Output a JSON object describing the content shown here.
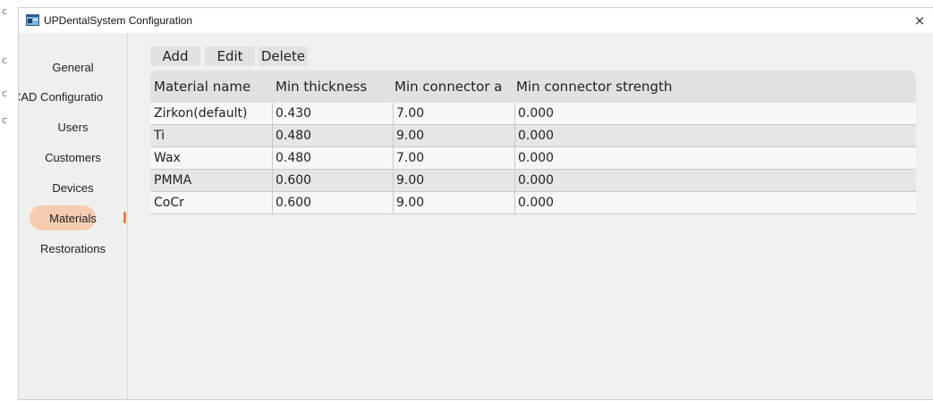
{
  "window": {
    "title": "UPDentalSystem Configuration",
    "close_glyph": "×",
    "app_icon": "app-icon"
  },
  "edge_fragments": [
    "c",
    "c",
    "c",
    "c",
    "c"
  ],
  "sidebar": {
    "items": [
      {
        "label": "General",
        "active": false
      },
      {
        "label": "CAD Configuratio",
        "active": false
      },
      {
        "label": "Users",
        "active": false
      },
      {
        "label": "Customers",
        "active": false
      },
      {
        "label": "Devices",
        "active": false
      },
      {
        "label": "Materials",
        "active": true
      },
      {
        "label": "Restorations",
        "active": false
      }
    ]
  },
  "toolbar": {
    "add_label": "Add",
    "edit_label": "Edit",
    "delete_label": "Delete"
  },
  "table": {
    "columns": [
      "Material name",
      "Min thickness",
      "Min connector a",
      "Min connector strength"
    ],
    "rows": [
      [
        "Zirkon(default)",
        "0.430",
        "7.00",
        "0.000"
      ],
      [
        "Ti",
        "0.480",
        "9.00",
        "0.000"
      ],
      [
        "Wax",
        "0.480",
        "7.00",
        "0.000"
      ],
      [
        "PMMA",
        "0.600",
        "9.00",
        "0.000"
      ],
      [
        "CoCr",
        "0.600",
        "9.00",
        "0.000"
      ]
    ]
  },
  "colors": {
    "accent": "#e8834a",
    "active_pill": "#f6cdb1",
    "header_bg": "#e1e1e1"
  }
}
